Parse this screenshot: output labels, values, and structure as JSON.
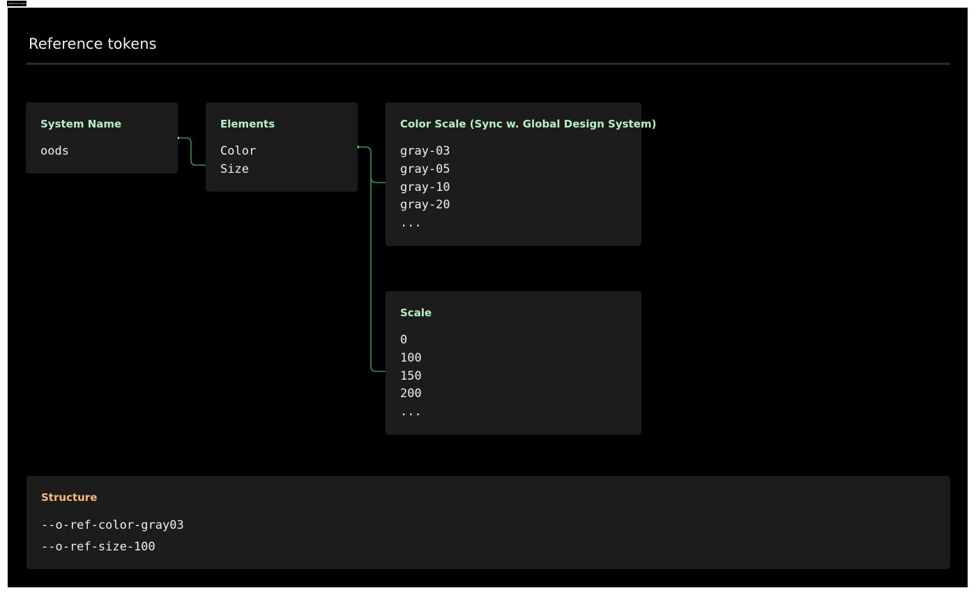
{
  "frame": {
    "tab_label": "Reference tokens"
  },
  "page": {
    "title": "Reference tokens"
  },
  "colors": {
    "background": "#000000",
    "card": "#1c1c1c",
    "accent_green": "#b5f2c4",
    "accent_orange": "#f7b97b",
    "connector": "#2fbf4f",
    "text": "#f0f0f0"
  },
  "nodes": {
    "system_name": {
      "title": "System Name",
      "items": [
        "oods"
      ]
    },
    "elements": {
      "title": "Elements",
      "items": [
        "Color",
        "Size"
      ]
    },
    "color_scale": {
      "title": "Color Scale (Sync w. Global Design System)",
      "items": [
        "gray-03",
        "gray-05",
        "gray-10",
        "gray-20",
        "..."
      ]
    },
    "scale": {
      "title": "Scale",
      "items": [
        "0",
        "100",
        "150",
        "200",
        "..."
      ]
    }
  },
  "structure": {
    "title": "Structure",
    "items": [
      "--o-ref-color-gray03",
      "--o-ref-size-100"
    ]
  },
  "edges": [
    {
      "from": "System Name",
      "to": "Elements"
    },
    {
      "from": "Elements",
      "to": "Color Scale (Sync w. Global Design System)"
    },
    {
      "from": "Elements",
      "to": "Scale"
    }
  ]
}
